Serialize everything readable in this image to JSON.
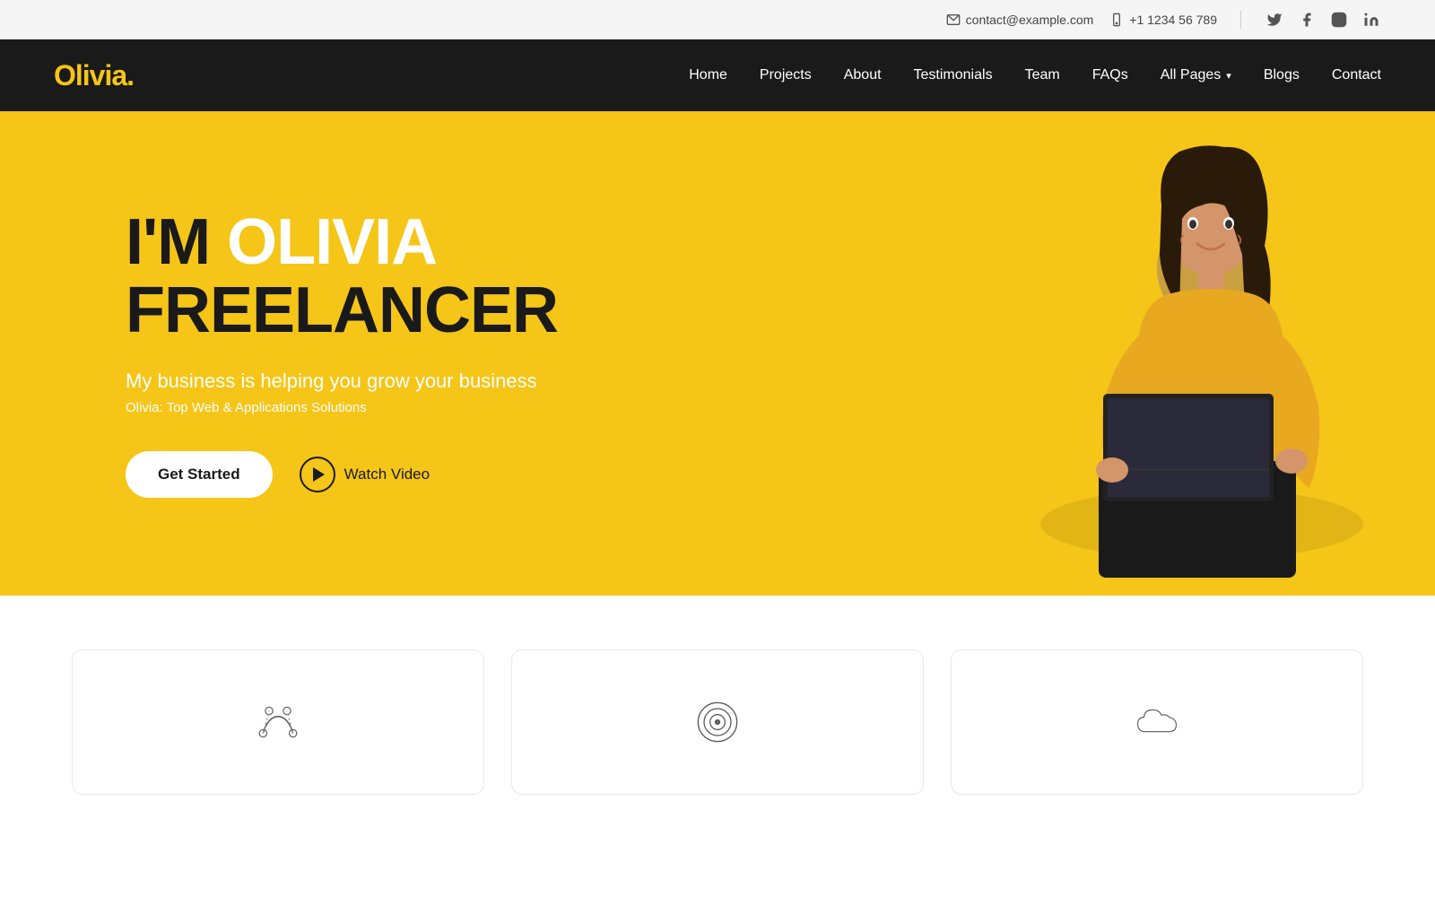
{
  "topbar": {
    "email": "contact@example.com",
    "phone": "+1 1234 56 789",
    "email_icon": "✉",
    "phone_icon": "📱"
  },
  "navbar": {
    "logo_text": "Olivia",
    "logo_dot": ".",
    "links": [
      {
        "label": "Home",
        "has_dropdown": false
      },
      {
        "label": "Projects",
        "has_dropdown": false
      },
      {
        "label": "About",
        "has_dropdown": false
      },
      {
        "label": "Testimonials",
        "has_dropdown": false
      },
      {
        "label": "Team",
        "has_dropdown": false
      },
      {
        "label": "FAQs",
        "has_dropdown": false
      },
      {
        "label": "All Pages",
        "has_dropdown": true
      },
      {
        "label": "Blogs",
        "has_dropdown": false
      },
      {
        "label": "Contact",
        "has_dropdown": false
      }
    ]
  },
  "hero": {
    "line1": "I'M OLIVIA",
    "line2_normal": "FREELANCER",
    "subheading": "My business is helping you grow your business",
    "sub2": "Olivia: Top Web & Applications Solutions",
    "btn_primary": "Get Started",
    "btn_secondary": "Watch Video"
  },
  "cards": [
    {
      "icon": "bezier"
    },
    {
      "icon": "target"
    },
    {
      "icon": "cloud"
    }
  ]
}
